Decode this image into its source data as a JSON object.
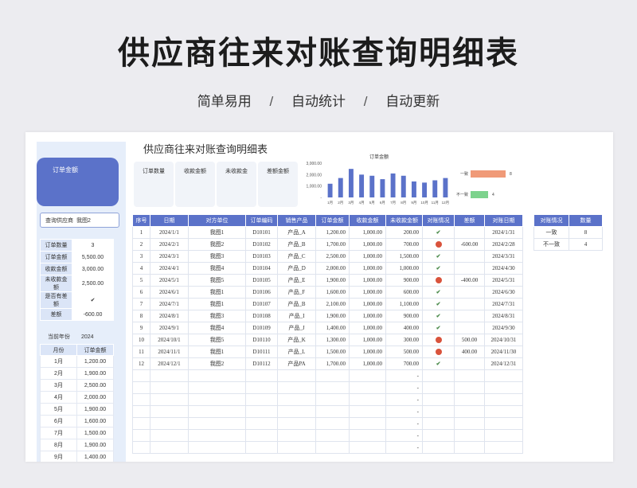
{
  "hero": {
    "title": "供应商往来对账查询明细表",
    "features": [
      "简单易用",
      "自动统计",
      "自动更新"
    ],
    "separator": "/"
  },
  "sheet": {
    "title": "供应商往来对账查询明细表",
    "kpi_card_label": "订单金额",
    "supplier_label": "查询供应商",
    "supplier_value": "我图2",
    "metrics": [
      "订单数量",
      "收款金额",
      "未收款金",
      "差额金额"
    ],
    "summary": [
      {
        "k": "订单数量",
        "v": "3"
      },
      {
        "k": "订单金额",
        "v": "5,500.00"
      },
      {
        "k": "收款金额",
        "v": "3,000.00"
      },
      {
        "k": "未收款金额",
        "v": "2,500.00"
      },
      {
        "k": "是否有差额",
        "v": "✔"
      },
      {
        "k": "差额",
        "v": "-600.00"
      }
    ],
    "year_label": "当前年份",
    "year_value": "2024",
    "month_headers": [
      "月份",
      "订单金额"
    ],
    "month_rows": [
      [
        "1月",
        "1,200.00"
      ],
      [
        "2月",
        "1,900.00"
      ],
      [
        "3月",
        "2,500.00"
      ],
      [
        "4月",
        "2,000.00"
      ],
      [
        "5月",
        "1,900.00"
      ],
      [
        "6月",
        "1,600.00"
      ],
      [
        "7月",
        "1,500.00"
      ],
      [
        "8月",
        "1,900.00"
      ],
      [
        "9月",
        "1,400.00"
      ]
    ],
    "table_headers": [
      "序号",
      "日期",
      "对方单位",
      "订单编码",
      "销售产品",
      "订单金额",
      "收款金额",
      "未收款金额",
      "对账情况",
      "差额",
      "对账日期"
    ],
    "rows": [
      [
        "1",
        "2024/1/1",
        "我图1",
        "D10101",
        "产品_A",
        "1,200.00",
        "1,000.00",
        "200.00",
        "check",
        "",
        "2024/1/31"
      ],
      [
        "2",
        "2024/2/1",
        "我图2",
        "D10102",
        "产品_B",
        "1,700.00",
        "1,000.00",
        "700.00",
        "dot",
        "-600.00",
        "2024/2/28"
      ],
      [
        "3",
        "2024/3/1",
        "我图3",
        "D10103",
        "产品_C",
        "2,500.00",
        "1,000.00",
        "1,500.00",
        "check",
        "",
        "2024/3/31"
      ],
      [
        "4",
        "2024/4/1",
        "我图4",
        "D10104",
        "产品_D",
        "2,000.00",
        "1,000.00",
        "1,000.00",
        "check",
        "",
        "2024/4/30"
      ],
      [
        "5",
        "2024/5/1",
        "我图5",
        "D10105",
        "产品_E",
        "1,900.00",
        "1,000.00",
        "900.00",
        "dot",
        "-400.00",
        "2024/5/31"
      ],
      [
        "6",
        "2024/6/1",
        "我图1",
        "D10106",
        "产品_F",
        "1,600.00",
        "1,000.00",
        "600.00",
        "check",
        "",
        "2024/6/30"
      ],
      [
        "7",
        "2024/7/1",
        "我图1",
        "D10107",
        "产品_B",
        "2,100.00",
        "1,000.00",
        "1,100.00",
        "check",
        "",
        "2024/7/31"
      ],
      [
        "8",
        "2024/8/1",
        "我图3",
        "D10108",
        "产品_I",
        "1,900.00",
        "1,000.00",
        "900.00",
        "check",
        "",
        "2024/8/31"
      ],
      [
        "9",
        "2024/9/1",
        "我图4",
        "D10109",
        "产品_J",
        "1,400.00",
        "1,000.00",
        "400.00",
        "check",
        "",
        "2024/9/30"
      ],
      [
        "10",
        "2024/10/1",
        "我图5",
        "D10110",
        "产品_K",
        "1,300.00",
        "1,000.00",
        "300.00",
        "dot",
        "500.00",
        "2024/10/31"
      ],
      [
        "11",
        "2024/11/1",
        "我图1",
        "D10111",
        "产品_L",
        "1,500.00",
        "1,000.00",
        "500.00",
        "dot",
        "400.00",
        "2024/11/30"
      ],
      [
        "12",
        "2024/12/1",
        "我图2",
        "D10112",
        "产品PA",
        "1,700.00",
        "1,000.00",
        "700.00",
        "check",
        "",
        "2024/12/31"
      ]
    ],
    "empty_rows": 7,
    "empty_dash": "-",
    "status_headers": [
      "对账情况",
      "数量"
    ],
    "status_rows": [
      [
        "一致",
        "8"
      ],
      [
        "不一致",
        "4"
      ]
    ]
  },
  "chart_data": [
    {
      "type": "bar",
      "title": "订单金额",
      "categories": [
        "1月",
        "2月",
        "3月",
        "4月",
        "5月",
        "6月",
        "7月",
        "8月",
        "9月",
        "10月",
        "11月",
        "12月"
      ],
      "values": [
        1200,
        1700,
        2500,
        2000,
        1900,
        1600,
        2100,
        1900,
        1400,
        1300,
        1500,
        1700
      ],
      "yticks": [
        "3,000.00",
        "2,000.00",
        "1,000.00",
        "-"
      ],
      "ylim": [
        0,
        3000
      ],
      "color": "#5b72c9"
    },
    {
      "type": "bar",
      "orientation": "horizontal",
      "categories": [
        "一致",
        "不一致"
      ],
      "values": [
        8,
        4
      ],
      "colors": [
        "#f09a78",
        "#7dd38d"
      ]
    }
  ]
}
